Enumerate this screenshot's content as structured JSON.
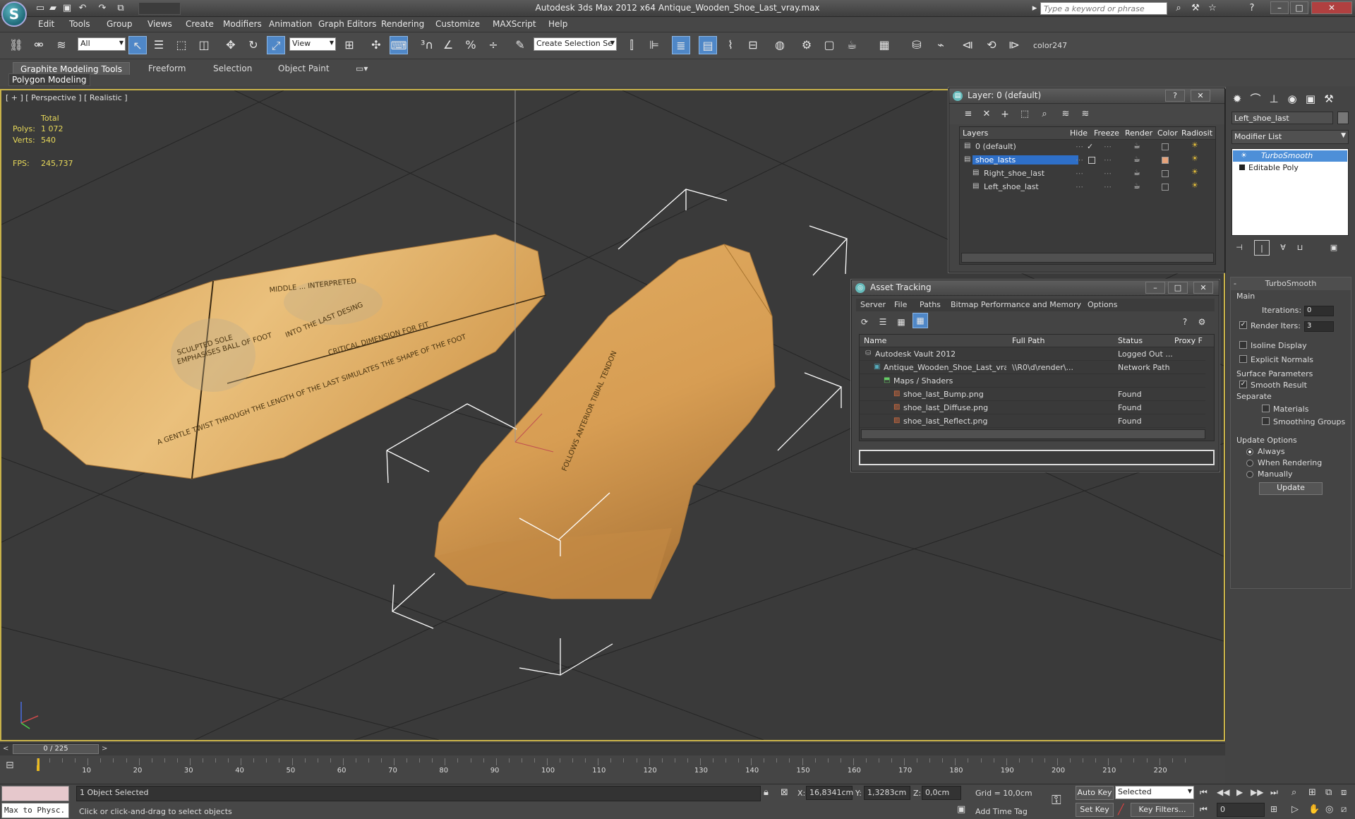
{
  "app": {
    "title": "Autodesk 3ds Max  2012 x64     Antique_Wooden_Shoe_Last_vray.max",
    "search_placeholder": "Type a keyword or phrase"
  },
  "menu": [
    "Edit",
    "Tools",
    "Group",
    "Views",
    "Create",
    "Modifiers",
    "Animation",
    "Graph Editors",
    "Rendering",
    "Customize",
    "MAXScript",
    "Help"
  ],
  "toolbar": {
    "filter_select": "All",
    "ref_coord_select": "View",
    "selection_set": "Create Selection Se",
    "color_label": "color247"
  },
  "ribbon": {
    "tabs": [
      "Graphite Modeling Tools",
      "Freeform",
      "Selection",
      "Object Paint"
    ],
    "active_tab": "Graphite Modeling Tools",
    "panel": "Polygon Modeling"
  },
  "viewport": {
    "label": "[ + ] [ Perspective ] [ Realistic ]",
    "stats": {
      "total": "Total",
      "polys_label": "Polys:",
      "polys": "1 072",
      "verts_label": "Verts:",
      "verts": "540",
      "fps_label": "FPS:",
      "fps": "245,737"
    },
    "left_shoe_annotations": [
      "SCULPTED SOLE",
      "EMPHASISES BALL OF FOOT",
      "INTO THE LAST DESING",
      "CRITICAL DIMENSION FOR FIT",
      "A GENTLE TWIST  THROUGH THE LENGTH OF THE LAST SIMULATES THE SHAPE OF THE FOOT",
      "MIDDLE ... INTERPRETED"
    ],
    "right_shoe_annotation": "FOLLOWS ANTERIOR TIBIAL TENDON"
  },
  "layer_window": {
    "title": "Layer: 0 (default)",
    "columns": [
      "Layers",
      "Hide",
      "Freeze",
      "Render",
      "Color",
      "Radiosit"
    ],
    "rows": [
      {
        "name": "0 (default)",
        "active": true,
        "selected": false,
        "color": "#3a3a3a"
      },
      {
        "name": "shoe_lasts",
        "active": false,
        "selected": true,
        "color": "#e7a37a"
      },
      {
        "name": "Right_shoe_last",
        "active": false,
        "selected": false,
        "color": "#3a3a3a"
      },
      {
        "name": "Left_shoe_last",
        "active": false,
        "selected": false,
        "color": "#3a3a3a"
      }
    ]
  },
  "asset_window": {
    "title": "Asset Tracking",
    "menu": [
      "Server",
      "File",
      "Paths",
      "Bitmap Performance and Memory",
      "Options"
    ],
    "columns": [
      "Name",
      "Full Path",
      "Status",
      "Proxy F"
    ],
    "rows": [
      {
        "name": "Autodesk Vault 2012",
        "path": "",
        "status": "Logged Out ..."
      },
      {
        "name": "Antique_Wooden_Shoe_Last_vray....",
        "path": "\\\\R0\\d\\render\\...",
        "status": "Network Path"
      },
      {
        "name": "Maps / Shaders",
        "path": "",
        "status": ""
      },
      {
        "name": "shoe_last_Bump.png",
        "path": "",
        "status": "Found"
      },
      {
        "name": "shoe_last_Diffuse.png",
        "path": "",
        "status": "Found"
      },
      {
        "name": "shoe_last_Reflect.png",
        "path": "",
        "status": "Found"
      }
    ]
  },
  "command_panel": {
    "object_name": "Left_shoe_last",
    "modifier_list": "Modifier List",
    "stack": [
      "TurboSmooth",
      "Editable Poly"
    ],
    "rollout_title": "TurboSmooth",
    "main_label": "Main",
    "iterations_label": "Iterations:",
    "iterations": "0",
    "render_iters_label": "Render Iters:",
    "render_iters": "3",
    "isoline": "Isoline Display",
    "explicit_normals": "Explicit Normals",
    "surface_params": "Surface Parameters",
    "smooth_result": "Smooth Result",
    "separate": "Separate",
    "materials": "Materials",
    "smoothing_groups": "Smoothing Groups",
    "update_options": "Update Options",
    "always": "Always",
    "when_rendering": "When Rendering",
    "manually": "Manually",
    "update_button": "Update"
  },
  "timeline": {
    "frame": "0 / 225",
    "ticks": [
      "10",
      "20",
      "30",
      "40",
      "50",
      "60",
      "70",
      "80",
      "90",
      "100",
      "110",
      "120",
      "130",
      "140",
      "150",
      "160",
      "170",
      "180",
      "190",
      "200",
      "210",
      "220"
    ]
  },
  "status": {
    "script_listener": "Max to Physc.",
    "selected": "1 Object Selected",
    "prompt": "Click or click-and-drag to select objects",
    "x_label": "X:",
    "x": "16,8341cm",
    "y_label": "Y:",
    "y": "1,3283cm",
    "z_label": "Z:",
    "z": "0,0cm",
    "grid": "Grid = 10,0cm",
    "add_time_tag": "Add Time Tag",
    "auto_key": "Auto Key",
    "set_key": "Set Key",
    "key_mode": "Selected",
    "key_filters": "Key Filters...",
    "frame_field": "0"
  }
}
